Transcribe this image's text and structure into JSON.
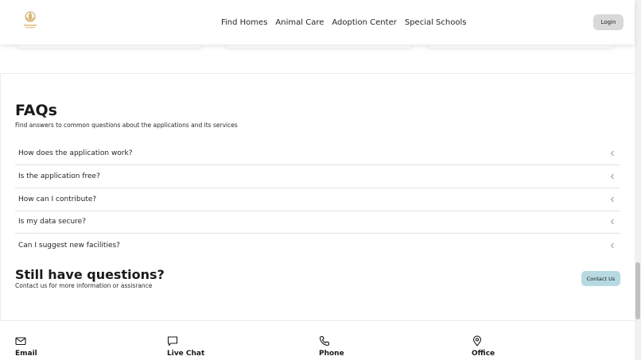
{
  "header": {
    "logo_icon": "lotus-logo-icon",
    "nav": [
      "Find Homes",
      "Animal Care",
      "Adoption Center",
      "Special Schools"
    ],
    "login_label": "Login"
  },
  "faq": {
    "title": "FAQs",
    "subtitle": "Find answers to common questions about the applications and its services",
    "items": [
      "How does the application work?",
      "Is the application free?",
      "How can I contribute?",
      "Is my data secure?",
      "Can I suggest new facilities?"
    ],
    "item_icon": "chevron-left-icon"
  },
  "contact_prompt": {
    "title": "Still have questions?",
    "subtitle": "Contact us for more information or assisrance",
    "button_label": "Contact Us"
  },
  "channels": [
    {
      "label": "Email",
      "icon": "mail-icon"
    },
    {
      "label": "Live Chat",
      "icon": "chat-icon"
    },
    {
      "label": "Phone",
      "icon": "phone-icon"
    },
    {
      "label": "Office",
      "icon": "map-pin-icon"
    }
  ],
  "colors": {
    "contact_button": "#b7d9e2",
    "login_button": "#d9d9d9",
    "logo": "#c9a25a"
  }
}
